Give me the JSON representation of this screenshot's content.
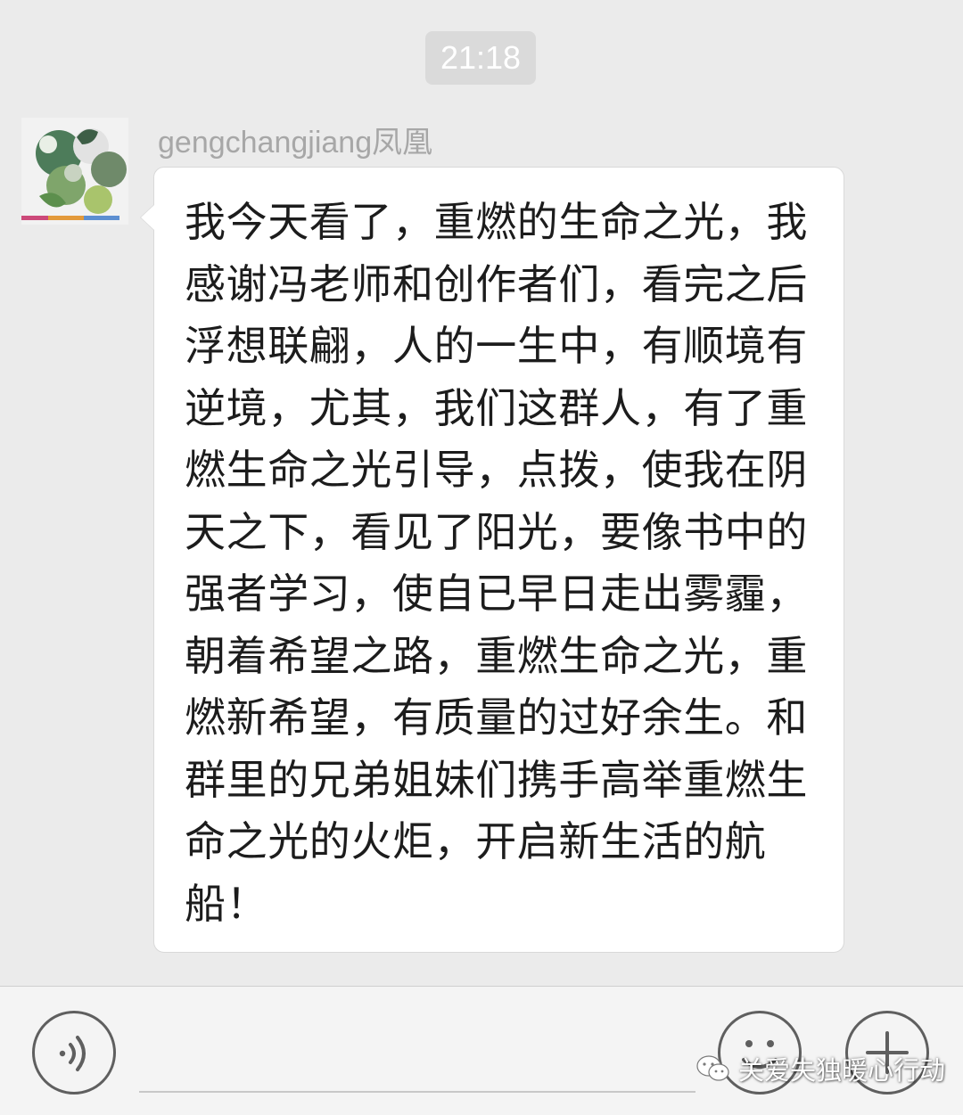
{
  "chat": {
    "timestamp": "21:18",
    "message": {
      "sender": "gengchangjiang凤凰",
      "text": "我今天看了，重燃的生命之光，我感谢冯老师和创作者们，看完之后浮想联翩，人的一生中，有顺境有逆境，尤其，我们这群人，有了重燃生命之光引导，点拨，使我在阴天之下，看见了阳光，要像书中的强者学习，使自已早日走出雾霾，朝着希望之路，重燃生命之光，重燃新希望，有质量的过好余生。和群里的兄弟姐妹们携手高举重燃生命之光的火炬，开启新生活的航船！"
    }
  },
  "input_bar": {
    "voice_icon": "voice-icon",
    "emoji_icon": "emoji-icon",
    "plus_icon": "plus-icon",
    "input_value": ""
  },
  "watermark": {
    "text": "关爱失独暖心行动",
    "icon": "wechat-icon"
  },
  "colors": {
    "background": "#ebebeb",
    "bubble": "#ffffff",
    "time_pill": "#dadada",
    "sender": "#a7a7a7"
  }
}
